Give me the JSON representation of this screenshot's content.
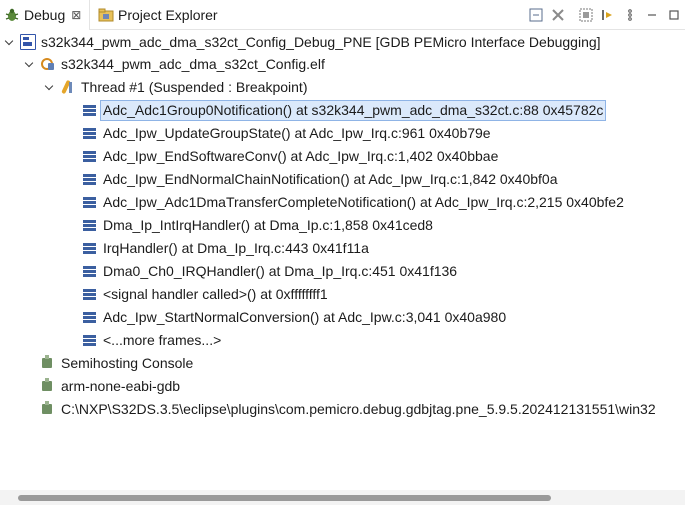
{
  "tabs": {
    "debug": {
      "label": "Debug",
      "close_glyph": "⊠",
      "icon": "bug-icon"
    },
    "project_explorer": {
      "label": "Project Explorer",
      "icon": "project-explorer-icon"
    }
  },
  "toolbar": {
    "icons": [
      "collapse-all-icon",
      "remove-terminated-icon",
      "debug-view-layout-icon",
      "step-filters-icon",
      "view-menu-icon",
      "minimize-icon",
      "maximize-icon"
    ]
  },
  "tree": {
    "launch": {
      "label": "s32k344_pwm_adc_dma_s32ct_Config_Debug_PNE [GDB PEMicro Interface Debugging]",
      "icon": "launch-config-icon"
    },
    "elf": {
      "label": "s32k344_pwm_adc_dma_s32ct_Config.elf",
      "icon": "elf-process-icon"
    },
    "thread": {
      "label": "Thread #1 (Suspended : Breakpoint)",
      "icon": "thread-icon"
    },
    "frames": [
      {
        "label": "Adc_Adc1Group0Notification() at s32k344_pwm_adc_dma_s32ct.c:88 0x45782c",
        "selected": true
      },
      {
        "label": "Adc_Ipw_UpdateGroupState() at Adc_Ipw_Irq.c:961 0x40b79e"
      },
      {
        "label": "Adc_Ipw_EndSoftwareConv() at Adc_Ipw_Irq.c:1,402 0x40bbae"
      },
      {
        "label": "Adc_Ipw_EndNormalChainNotification() at Adc_Ipw_Irq.c:1,842 0x40bf0a"
      },
      {
        "label": "Adc_Ipw_Adc1DmaTransferCompleteNotification() at Adc_Ipw_Irq.c:2,215 0x40bfe2"
      },
      {
        "label": "Dma_Ip_IntIrqHandler() at Dma_Ip.c:1,858 0x41ced8"
      },
      {
        "label": "IrqHandler() at Dma_Ip_Irq.c:443 0x41f11a"
      },
      {
        "label": "Dma0_Ch0_IRQHandler() at Dma_Ip_Irq.c:451 0x41f136"
      },
      {
        "label": "<signal handler called>() at 0xffffffff1"
      },
      {
        "label": "Adc_Ipw_StartNormalConversion() at Adc_Ipw.c:3,041 0x40a980"
      },
      {
        "label": "<...more frames...>"
      }
    ],
    "processes": [
      {
        "label": "Semihosting Console"
      },
      {
        "label": "arm-none-eabi-gdb"
      },
      {
        "label": "C:\\NXP\\S32DS.3.5\\eclipse\\plugins\\com.pemicro.debug.gdbjtag.pne_5.9.5.202412131551\\win32"
      }
    ]
  },
  "scrollbar": {
    "horizontal_position_fraction": 0.0
  }
}
